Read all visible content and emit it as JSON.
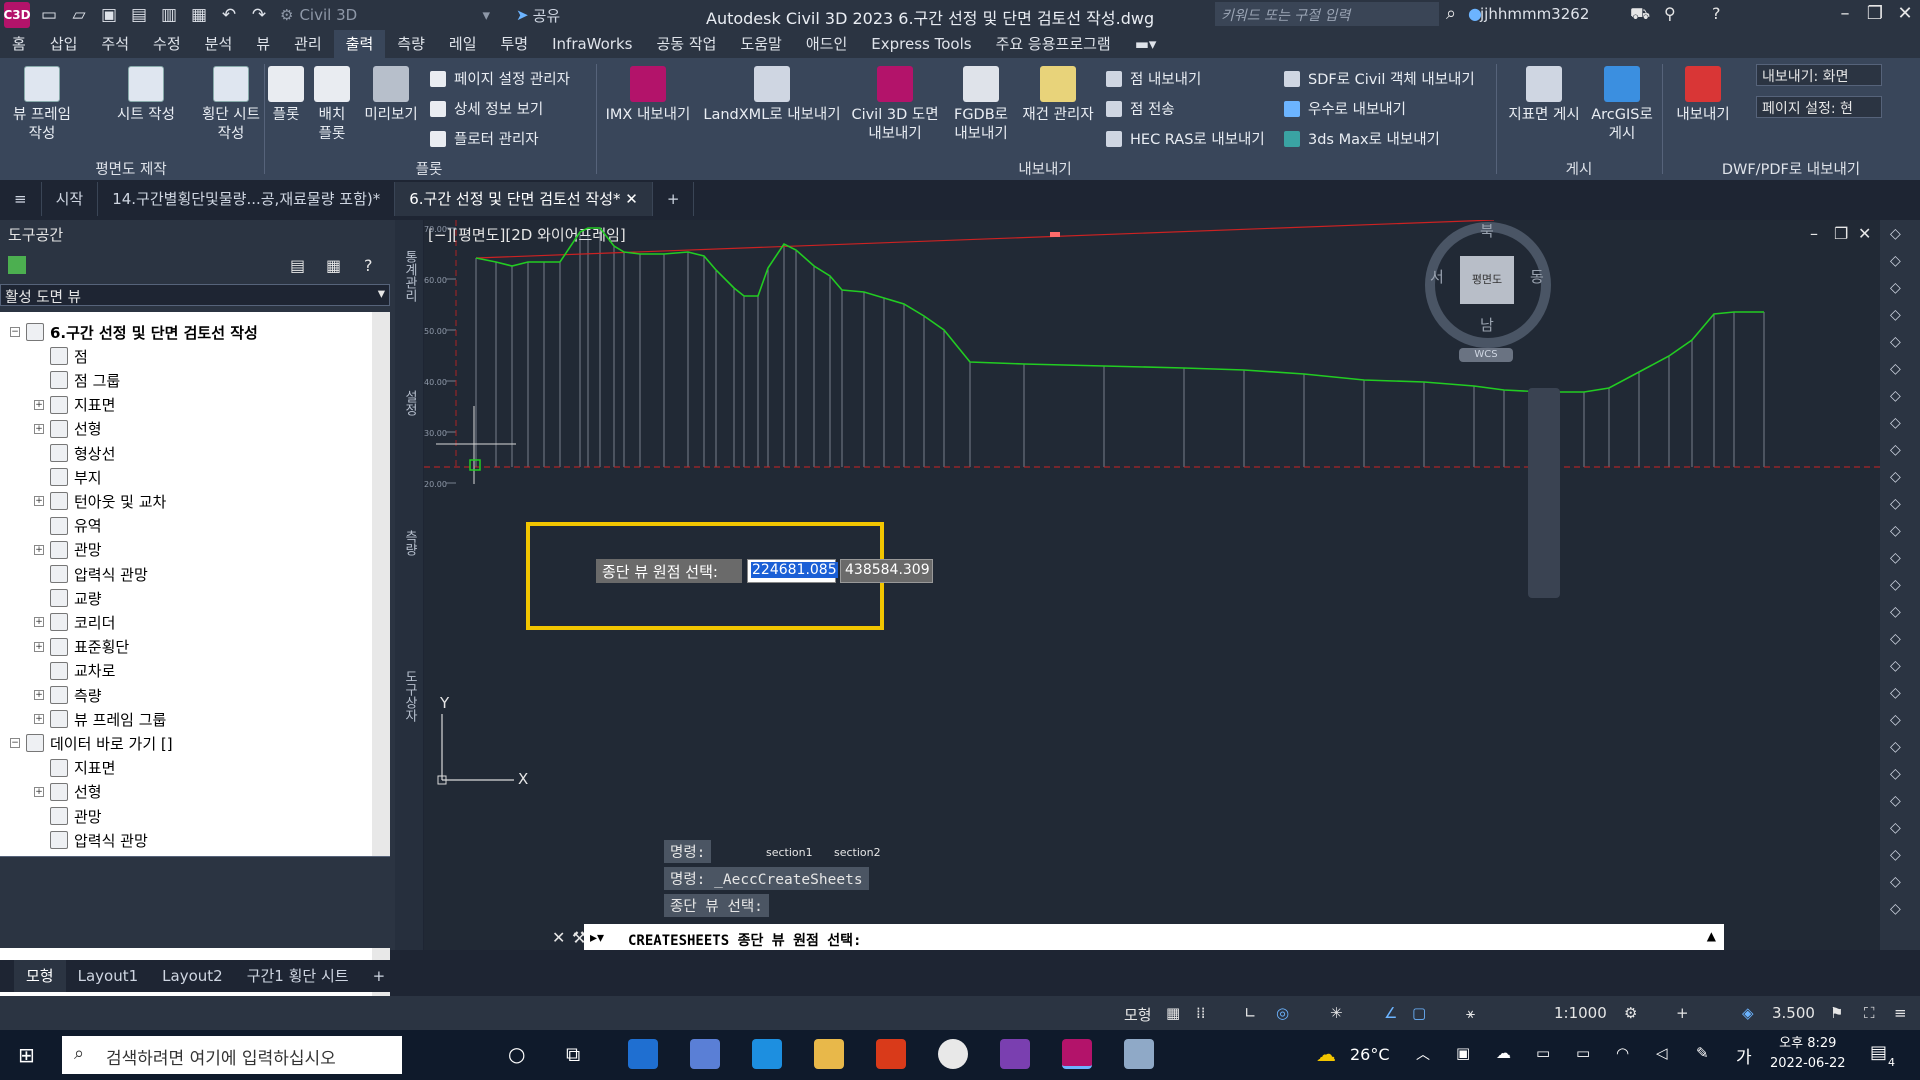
{
  "titlebar": {
    "app_logo": "C3D",
    "workspace": "Civil 3D",
    "share": "공유",
    "title": "Autodesk Civil 3D 2023    6.구간 선정 및 단면 검토선 작성.dwg",
    "search_placeholder": "키워드 또는 구절 입력",
    "user": "jjhhmmm3262"
  },
  "ribbon_tabs": [
    "홈",
    "삽입",
    "주석",
    "수정",
    "분석",
    "뷰",
    "관리",
    "출력",
    "측량",
    "레일",
    "투명",
    "InfraWorks",
    "공동 작업",
    "도움말",
    "애드인",
    "Express Tools",
    "주요 응용프로그램"
  ],
  "active_ribbon_tab": "출력",
  "ribbon": {
    "plan_panel": {
      "label": "평면도 제작",
      "buttons": [
        "뷰 프레임 작성",
        "시트 작성",
        "횡단 시트 작성"
      ]
    },
    "plot_panel": {
      "label": "플롯",
      "buttons": [
        "플롯",
        "배치 플롯",
        "미리보기"
      ],
      "small": [
        "페이지 설정 관리자",
        "상세 정보 보기",
        "플로터 관리자"
      ]
    },
    "export_panel": {
      "label": "내보내기",
      "buttons": [
        "IMX 내보내기",
        "LandXML로 내보내기",
        "Civil 3D 도면 내보내기",
        "FGDB로 내보내기",
        "재건 관리자"
      ],
      "small": [
        "점 내보내기",
        "점 전송",
        "HEC RAS로 내보내기",
        "SDF로 Civil 객체 내보내기",
        "우수로 내보내기",
        "3ds Max로 내보내기"
      ]
    },
    "publish_panel": {
      "label": "게시",
      "buttons": [
        "지표면 게시",
        "ArcGIS로 게시"
      ]
    },
    "dwf_panel": {
      "label": "DWF/PDF로 내보내기",
      "button": "내보내기",
      "export_sel": "내보내기: 화면",
      "page_sel": "페이지 설정: 현"
    }
  },
  "doc_tabs": [
    "시작",
    "14.구간별횡단및물량...공,재료물량 포함)*",
    "6.구간 선정 및 단면 검토선 작성*"
  ],
  "active_doc_tab": "6.구간 선정 및 단면 검토선 작성*",
  "toolspace": {
    "title": "도구공간",
    "view_selector": "활성 도면 뷰",
    "tree": [
      {
        "label": "6.구간 선정 및 단면 검토선 작성",
        "level": 0,
        "expander": "−",
        "bold": true
      },
      {
        "label": "점",
        "level": 1,
        "expander": ""
      },
      {
        "label": "점 그룹",
        "level": 1,
        "expander": ""
      },
      {
        "label": "지표면",
        "level": 1,
        "expander": "+"
      },
      {
        "label": "선형",
        "level": 1,
        "expander": "+"
      },
      {
        "label": "형상선",
        "level": 1,
        "expander": ""
      },
      {
        "label": "부지",
        "level": 1,
        "expander": ""
      },
      {
        "label": "턴아웃 및 교차",
        "level": 1,
        "expander": "+"
      },
      {
        "label": "유역",
        "level": 1,
        "expander": ""
      },
      {
        "label": "관망",
        "level": 1,
        "expander": "+"
      },
      {
        "label": "압력식 관망",
        "level": 1,
        "expander": ""
      },
      {
        "label": "교량",
        "level": 1,
        "expander": ""
      },
      {
        "label": "코리더",
        "level": 1,
        "expander": "+"
      },
      {
        "label": "표준횡단",
        "level": 1,
        "expander": "+"
      },
      {
        "label": "교차로",
        "level": 1,
        "expander": ""
      },
      {
        "label": "측량",
        "level": 1,
        "expander": "+"
      },
      {
        "label": "뷰 프레임 그룹",
        "level": 1,
        "expander": "+"
      },
      {
        "label": "데이터 바로 가기 []",
        "level": 0,
        "expander": "−",
        "bold": false
      },
      {
        "label": "지표면",
        "level": 1,
        "expander": ""
      },
      {
        "label": "선형",
        "level": 1,
        "expander": "+"
      },
      {
        "label": "관망",
        "level": 1,
        "expander": ""
      },
      {
        "label": "압력식 관망",
        "level": 1,
        "expander": ""
      }
    ],
    "vertical_tabs": [
      "통계관리",
      "설정",
      "측량",
      "도구상자"
    ]
  },
  "viewport": {
    "label": "[−][평면도][2D 와이어프레임]",
    "compass": {
      "north": "북",
      "south": "남",
      "east": "동",
      "west": "서",
      "center": "평면도",
      "wcs": "WCS"
    },
    "y_ticks": [
      "70.00",
      "60.00",
      "50.00",
      "40.00",
      "30.00",
      "20.00"
    ],
    "prompt_label": "종단 뷰 원점 선택:",
    "x_value": "224681.085",
    "y_value": "438584.309",
    "history": [
      "명령:",
      "명령: _AeccCreateSheets",
      "종단 뷰 선택:"
    ],
    "section_labels": [
      "section1",
      "section2"
    ],
    "command_line": "CREATESHEETS 종단 뷰 원점 선택:",
    "ucs_x": "X",
    "ucs_y": "Y"
  },
  "layout_tabs": [
    "모형",
    "Layout1",
    "Layout2",
    "구간1 횡단 시트"
  ],
  "active_layout_tab": "모형",
  "statusbar": {
    "model_label": "모형",
    "scale": "1:1000",
    "value": "3.500"
  },
  "taskbar": {
    "search_placeholder": "검색하려면 여기에 입력하십시오",
    "temperature": "26°C",
    "ime": "가",
    "time": "오후 8:29",
    "date": "2022-06-22",
    "notifications": "4"
  },
  "colors": {
    "profile_line": "#22cc22",
    "tangent_line": "#cc2222",
    "selection_box": "#f2c500"
  }
}
